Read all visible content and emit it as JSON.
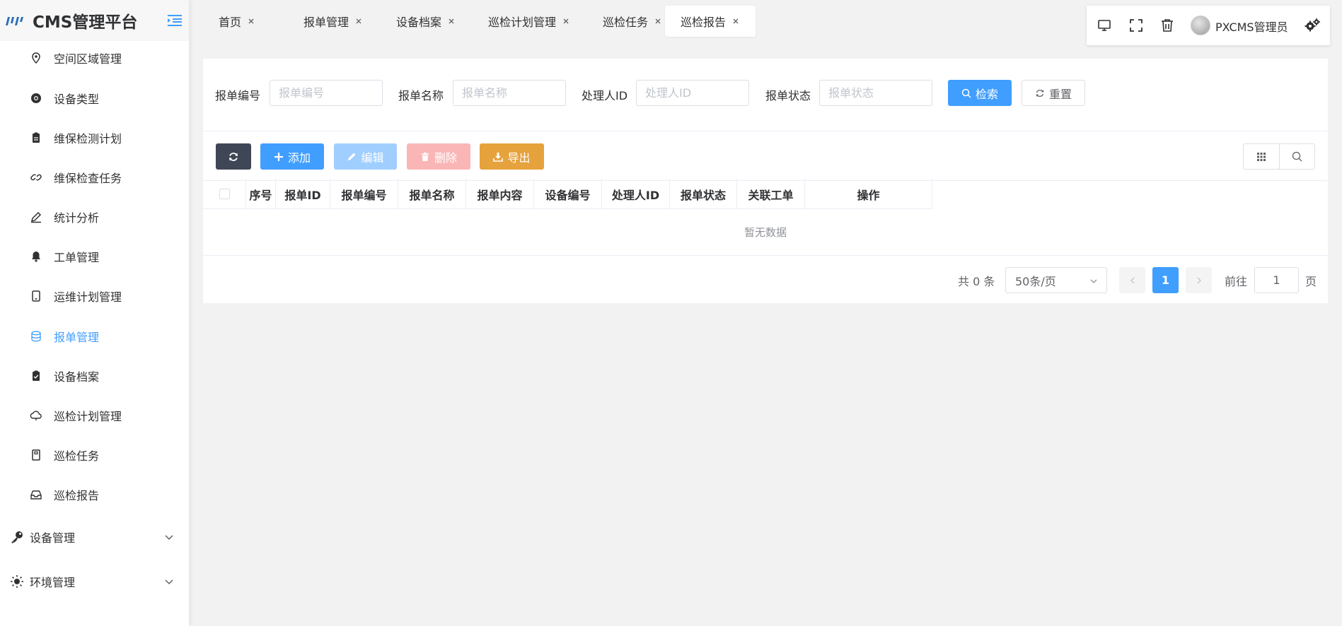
{
  "app": {
    "title": "CMS管理平台"
  },
  "sidebar": {
    "items": [
      {
        "label": "空间区域管理",
        "icon": "location-pin-icon"
      },
      {
        "label": "设备类型",
        "icon": "chrome-icon"
      },
      {
        "label": "维保检测计划",
        "icon": "clipboard-icon"
      },
      {
        "label": "维保检查任务",
        "icon": "link-icon"
      },
      {
        "label": "统计分析",
        "icon": "pen-icon"
      },
      {
        "label": "工单管理",
        "icon": "bell-icon"
      },
      {
        "label": "运维计划管理",
        "icon": "tablet-icon"
      },
      {
        "label": "报单管理",
        "icon": "database-icon",
        "active": true
      },
      {
        "label": "设备档案",
        "icon": "clipboard-check-icon"
      },
      {
        "label": "巡检计划管理",
        "icon": "cloud-icon"
      },
      {
        "label": "巡检任务",
        "icon": "notebook-icon"
      },
      {
        "label": "巡检报告",
        "icon": "inbox-icon"
      }
    ],
    "groups": [
      {
        "label": "设备管理",
        "icon": "key-icon"
      },
      {
        "label": "环境管理",
        "icon": "sun-icon"
      }
    ]
  },
  "tabs": [
    {
      "label": "首页"
    },
    {
      "label": "报单管理"
    },
    {
      "label": "设备档案"
    },
    {
      "label": "巡检计划管理"
    },
    {
      "label": "巡检任务"
    },
    {
      "label": "巡检报告",
      "active": true
    }
  ],
  "topbar": {
    "user": "PXCMS管理员"
  },
  "search": {
    "fields": [
      {
        "label": "报单编号",
        "placeholder": "报单编号"
      },
      {
        "label": "报单名称",
        "placeholder": "报单名称"
      },
      {
        "label": "处理人ID",
        "placeholder": "处理人ID"
      },
      {
        "label": "报单状态",
        "placeholder": "报单状态"
      }
    ],
    "search_label": "检索",
    "reset_label": "重置"
  },
  "toolbar": {
    "add_label": "添加",
    "edit_label": "编辑",
    "delete_label": "删除",
    "export_label": "导出"
  },
  "table": {
    "columns": [
      "序号",
      "报单ID",
      "报单编号",
      "报单名称",
      "报单内容",
      "设备编号",
      "处理人ID",
      "报单状态",
      "关联工单",
      "操作"
    ],
    "empty_text": "暂无数据"
  },
  "pagination": {
    "total_text": "共 0 条",
    "page_size": "50条/页",
    "current_page": "1",
    "goto_label": "前往",
    "goto_value": "1",
    "goto_suffix": "页"
  },
  "colors": {
    "primary": "#409eff",
    "dark": "#3f4656",
    "warning": "#e6a23c",
    "danger_disabled": "#fab6b6",
    "primary_disabled": "#a0cfff"
  }
}
